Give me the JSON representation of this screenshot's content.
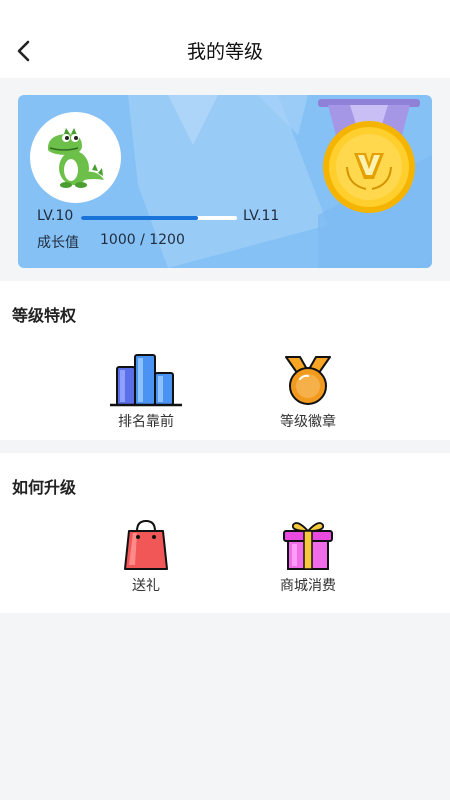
{
  "header": {
    "title": "我的等级",
    "back_icon": "back-arrow-icon"
  },
  "level_card": {
    "avatar_icon": "dinosaur-avatar-icon",
    "current_level": "LV.10",
    "next_level": "LV.11",
    "progress_fraction": 0.75,
    "growth_label": "成长值",
    "growth_value": "1000 / 1200",
    "medal_icon": "gold-v-medal-icon",
    "accent": "#1a73d9",
    "card_color": "#86c1f6"
  },
  "privileges": {
    "title": "等级特权",
    "items": [
      {
        "label": "排名靠前",
        "icon": "ranking-bars-icon"
      },
      {
        "label": "等级徽章",
        "icon": "medal-badge-icon"
      }
    ]
  },
  "upgrade": {
    "title": "如何升级",
    "items": [
      {
        "label": "送礼",
        "icon": "shopping-bag-icon"
      },
      {
        "label": "商城消费",
        "icon": "gift-box-icon"
      }
    ]
  }
}
